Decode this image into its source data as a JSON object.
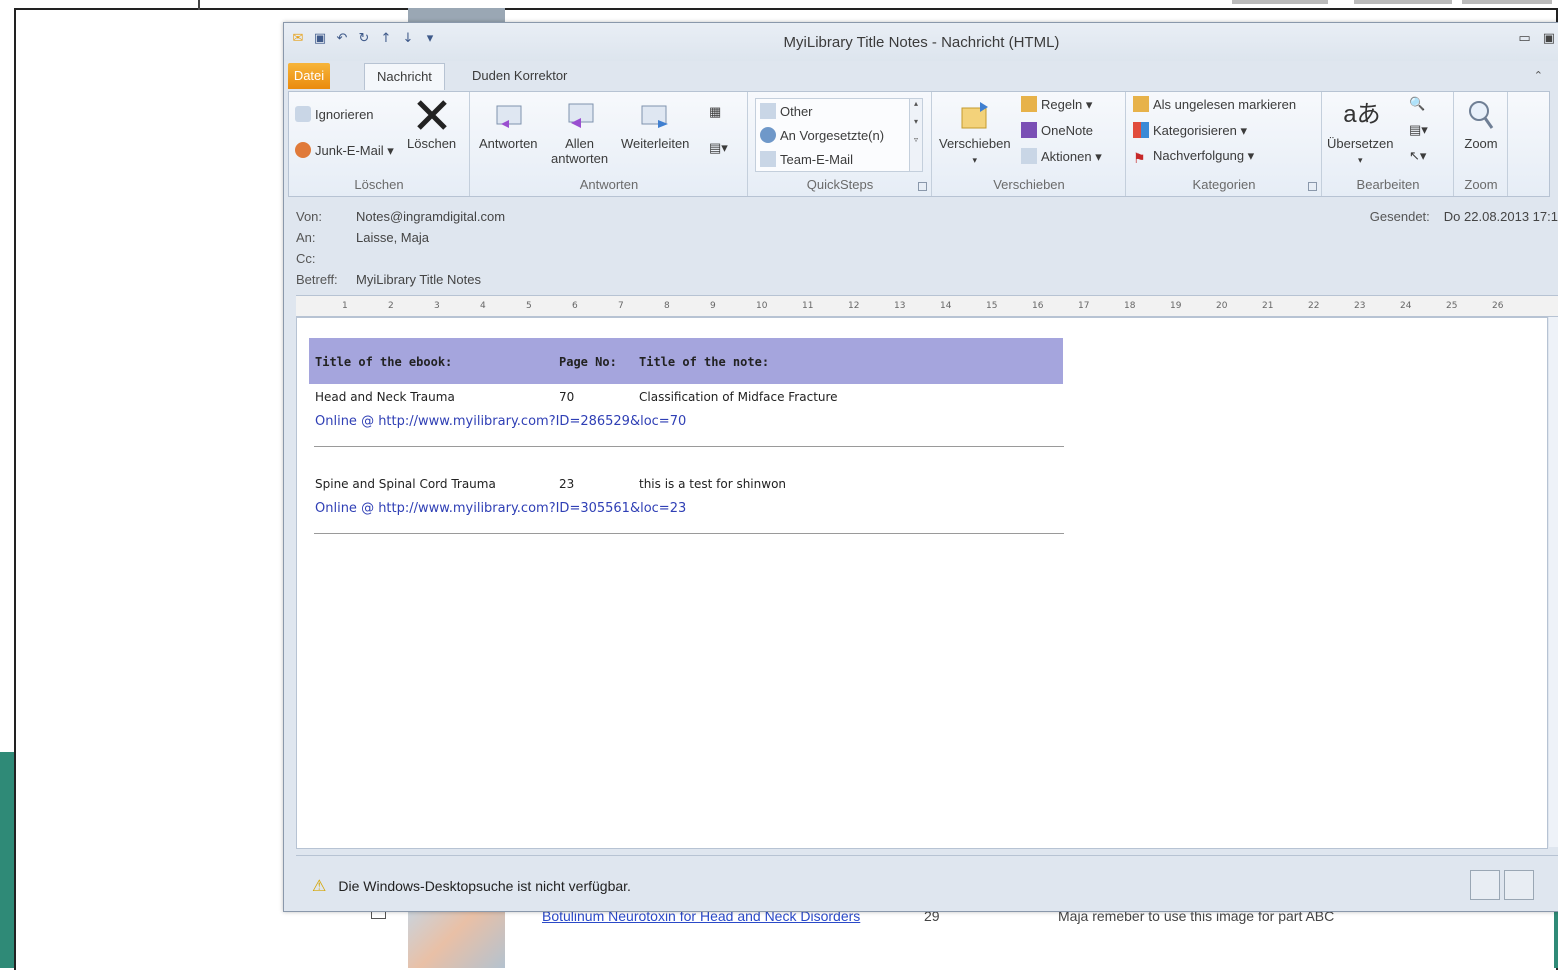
{
  "window": {
    "title": "MyiLibrary Title Notes  -  Nachricht (HTML)"
  },
  "tabs": {
    "file": "Datei",
    "message": "Nachricht",
    "duden": "Duden Korrektor"
  },
  "ribbon": {
    "loeschen": {
      "label": "Löschen",
      "ignore": "Ignorieren",
      "junk": "Junk-E-Mail",
      "delete": "Löschen"
    },
    "antworten": {
      "label": "Antworten",
      "reply": "Antworten",
      "reply_all_1": "Allen",
      "reply_all_2": "antworten",
      "forward": "Weiterleiten"
    },
    "quicksteps": {
      "label": "QuickSteps",
      "items": [
        "Other",
        "An Vorgesetzte(n)",
        "Team-E-Mail"
      ]
    },
    "verschieben": {
      "label": "Verschieben",
      "move": "Verschieben",
      "rules": "Regeln",
      "onenote": "OneNote",
      "actions": "Aktionen"
    },
    "kategorien": {
      "label": "Kategorien",
      "unread": "Als ungelesen markieren",
      "categorize": "Kategorisieren",
      "followup": "Nachverfolgung"
    },
    "bearbeiten": {
      "label": "Bearbeiten",
      "translate": "Übersetzen"
    },
    "zoom": {
      "label": "Zoom",
      "zoom": "Zoom"
    }
  },
  "header": {
    "from_label": "Von:",
    "from": "Notes@ingramdigital.com",
    "to_label": "An:",
    "to": "Laisse, Maja",
    "cc_label": "Cc:",
    "subject_label": "Betreff:",
    "subject": "MyiLibrary Title Notes",
    "sent_label": "Gesendet:",
    "sent": "Do 22.08.2013 17:1"
  },
  "table": {
    "col_title": "Title of the ebook:",
    "col_page": "Page No:",
    "col_note": "Title of the note:",
    "rows": [
      {
        "title": "Head and Neck Trauma",
        "page": "70",
        "note": "Classification of Midface Fracture",
        "link": "Online @ http://www.myilibrary.com?ID=286529&loc=70"
      },
      {
        "title": "Spine and Spinal Cord Trauma",
        "page": "23",
        "note": "this is a test for shinwon",
        "link": "Online @ http://www.myilibrary.com?ID=305561&loc=23"
      }
    ]
  },
  "status": {
    "warning": "Die Windows-Desktopsuche ist nicht verfügbar."
  },
  "background_row": {
    "title": "Botulinum Neurotoxin for Head and Neck Disorders",
    "page": "29",
    "note": "Maja remeber to use this image for part ABC"
  },
  "ruler_ticks": [
    "1",
    "2",
    "3",
    "4",
    "5",
    "6",
    "7",
    "8",
    "9",
    "10",
    "11",
    "12",
    "13",
    "14",
    "15",
    "16",
    "17",
    "18",
    "19",
    "20",
    "21",
    "22",
    "23",
    "24",
    "25",
    "26"
  ],
  "colors": {
    "table_header": "#a5a5dd",
    "link": "#2f3fb5",
    "file_tab": "#ea8b0e"
  }
}
